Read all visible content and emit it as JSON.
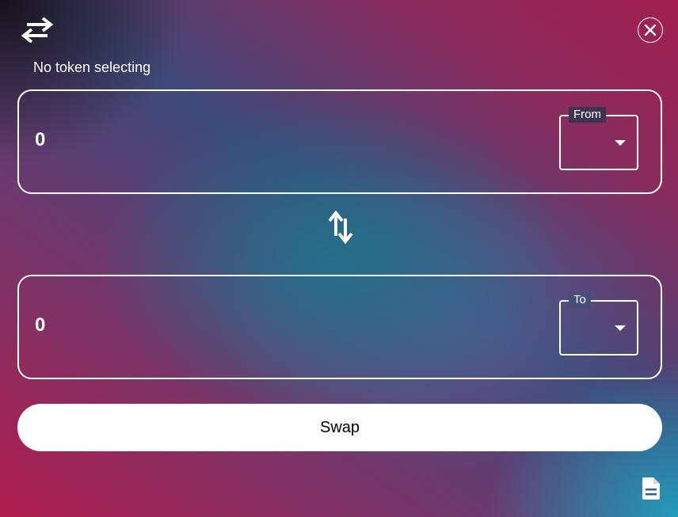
{
  "header": {
    "app_icon": "swap-horizontal-icon",
    "close_icon": "close-circle-icon"
  },
  "status": {
    "text": "No token selecting"
  },
  "from_card": {
    "amount": "0",
    "select_label": "From",
    "selected_value": "",
    "dropdown_icon": "caret-down-icon"
  },
  "switch": {
    "icon": "swap-vertical-icon"
  },
  "to_card": {
    "amount": "0",
    "select_label": "To",
    "selected_value": "",
    "dropdown_icon": "caret-down-icon"
  },
  "actions": {
    "swap_label": "Swap"
  },
  "footer": {
    "doc_icon": "document-icon"
  },
  "colors": {
    "foreground": "#ffffff",
    "button_bg": "#ffffff",
    "button_text": "#000000"
  }
}
